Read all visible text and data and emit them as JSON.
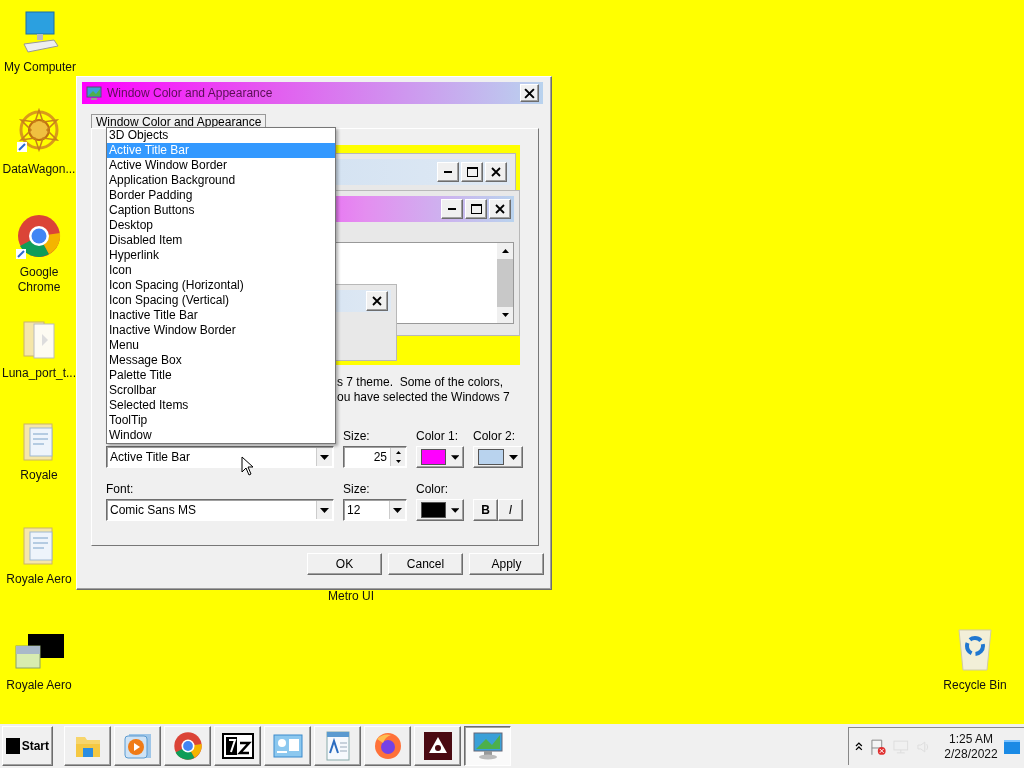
{
  "desktop_icons": [
    {
      "label": "My Computer"
    },
    {
      "label": "DataWagon..."
    },
    {
      "label": "Google Chrome"
    },
    {
      "label": "Luna_port_t..."
    },
    {
      "label": "Royale"
    },
    {
      "label": "Royale Aero"
    },
    {
      "label": "Royale Aero"
    },
    {
      "label": "Recycle Bin"
    }
  ],
  "desktop_label": "Metro UI",
  "dialog": {
    "title": "Window Color and Appearance",
    "tabs": [
      {
        "label": "Window Color and Appearance",
        "selected": true
      }
    ],
    "description": [
      "s 7 theme.  Some of the colors,",
      "ou have selected the Windows 7"
    ],
    "item_list": {
      "expanded": true,
      "options": [
        {
          "label": "3D Objects",
          "selected": false
        },
        {
          "label": "Active Title Bar",
          "selected": true
        },
        {
          "label": "Active Window Border",
          "selected": false
        },
        {
          "label": "Application Background",
          "selected": false
        },
        {
          "label": "Border Padding",
          "selected": false
        },
        {
          "label": "Caption Buttons",
          "selected": false
        },
        {
          "label": "Desktop",
          "selected": false
        },
        {
          "label": "Disabled Item",
          "selected": false
        },
        {
          "label": "Hyperlink",
          "selected": false
        },
        {
          "label": "Icon",
          "selected": false
        },
        {
          "label": "Icon Spacing (Horizontal)",
          "selected": false
        },
        {
          "label": "Icon Spacing (Vertical)",
          "selected": false
        },
        {
          "label": "Inactive Title Bar",
          "selected": false
        },
        {
          "label": "Inactive Window Border",
          "selected": false
        },
        {
          "label": "Menu",
          "selected": false
        },
        {
          "label": "Message Box",
          "selected": false
        },
        {
          "label": "Palette Title",
          "selected": false
        },
        {
          "label": "Scrollbar",
          "selected": false
        },
        {
          "label": "Selected Items",
          "selected": false
        },
        {
          "label": "ToolTip",
          "selected": false
        },
        {
          "label": "Window",
          "selected": false
        }
      ]
    },
    "item_value": "Active Title Bar",
    "size_label": "Size:",
    "size_value": "25",
    "color1": {
      "label": "Color 1:",
      "color": "#ff00ff"
    },
    "color2": {
      "label": "Color 2:",
      "color": "#b9d3ee"
    },
    "font_label": "Font:",
    "font_value": "Comic Sans MS",
    "font_size_label": "Size:",
    "font_size_value": "12",
    "font_color": {
      "label": "Color:",
      "color": "#000000"
    },
    "bold_label": "B",
    "italic_label": "I",
    "buttons": [
      {
        "label": "OK"
      },
      {
        "label": "Cancel"
      },
      {
        "label": "Apply"
      }
    ]
  },
  "taskbar": {
    "start_label": "Start",
    "apps": [
      {
        "selected": false
      },
      {
        "selected": false
      },
      {
        "selected": false
      },
      {
        "selected": false
      },
      {
        "selected": false
      },
      {
        "selected": false
      },
      {
        "selected": false
      },
      {
        "selected": false
      },
      {
        "selected": true
      }
    ],
    "clock": {
      "time": "1:25 AM",
      "date": "2/28/2022"
    }
  }
}
